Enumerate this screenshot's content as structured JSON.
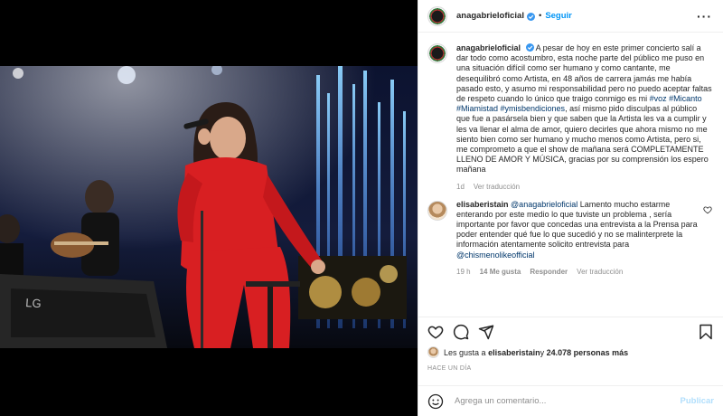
{
  "post": {
    "username": "anagabrieloficial",
    "separator": "•",
    "follow_label": "Seguir",
    "more_icon": "more-horizontal-icon"
  },
  "caption": {
    "username": "anagabrieloficial",
    "text_1": "A pesar de hoy en este primer concierto salí a dar todo como acostumbro, esta noche parte del público me puso en una situación difícil como ser humano y como cantante, me desequilibró como Artista, en 48 años de carrera jamás me había pasado esto, y asumo mi responsabilidad pero no puedo aceptar faltas de respeto cuando lo único que traigo conmigo es mi ",
    "hashtags": "#voz #Micanto #Miamistad #ymisbendiciones",
    "text_2": ", así mismo pido disculpas al público que fue a pasársela bien y que saben que la Artista les va a cumplir y les va llenar el alma de amor, quiero decirles que ahora mismo no me siento bien como ser humano y mucho menos como Artista, pero si, me comprometo a que el show de mañana será COMPLETAMENTE LLENO DE AMOR Y MÚSICA, gracias por su comprensión los espero mañana",
    "time": "1d",
    "translate": "Ver traducción"
  },
  "reply": {
    "username": "elisaberistain",
    "mention": "@anagabrieloficial",
    "text_1": " Lamento mucho estarme enterando por este medio lo que tuviste un problema , sería importante por favor que concedas una entrevista a la Prensa para poder entender qué fue lo que sucedió y no se malinterprete la información atentamente solicito entrevista para ",
    "mention_2": "@chismenolikeofficial",
    "time": "19 h",
    "likes": "14 Me gusta",
    "reply_label": "Responder",
    "translate": "Ver traducción"
  },
  "likes": {
    "prefix": "Les gusta a ",
    "user": "elisaberistain",
    "middle": " y ",
    "count": "24.078 personas más"
  },
  "ago": "HACE UN DÍA",
  "add_comment": {
    "placeholder": "Agrega un comentario...",
    "publish_label": "Publicar"
  },
  "photo": {
    "logo_text": "LG"
  },
  "colors": {
    "link": "#0095f6",
    "hashtag": "#00376b",
    "muted": "#8e8e8e",
    "verified": "#3897f0",
    "outfit_red": "#d81f22"
  }
}
